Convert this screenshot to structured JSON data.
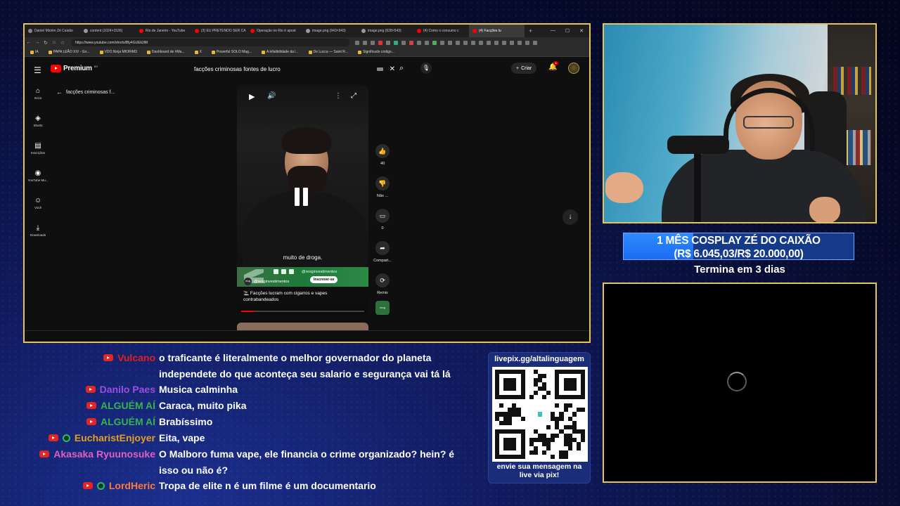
{
  "browser": {
    "tabs": [
      {
        "label": "Daniel Miorim Zé Caixão",
        "color": "#888888",
        "active": false
      },
      {
        "label": "content (1024×1536)",
        "color": "#9a9a9a",
        "active": false
      },
      {
        "label": "Rio de Janeiro - YouTube",
        "color": "#ff0000",
        "active": false
      },
      {
        "label": "(3) EU PRETENDO SER CA",
        "color": "#ff0000",
        "active": false
      },
      {
        "label": "Operação no Rio é apost",
        "color": "#ff0000",
        "active": false
      },
      {
        "label": "image.png (943×943)",
        "color": "#9a9a9a",
        "active": false
      },
      {
        "label": "image.png (628×543)",
        "color": "#9a9a9a",
        "active": false
      },
      {
        "label": "(4) Como o consumo c",
        "color": "#ff0000",
        "active": false
      },
      {
        "label": "(4) Facções lu",
        "color": "#ff0000",
        "active": true
      }
    ],
    "new_tab": "+",
    "url": "https://www.youtube.com/shorts/lBy4GUEk2iM",
    "bookmarks": [
      "IA",
      "PAPA LEÃO XIV - Go...",
      "VDO.Ninja MIORIM3",
      "Dashboard de #Ma...",
      "X",
      "Powerful SOLO Mag...",
      "A infalibilidade da l...",
      "De Lucca — Saint R...",
      "Significado código..."
    ]
  },
  "youtube": {
    "logo": "Premium",
    "logo_region": "BR",
    "search_value": "facções criminosas fontes de lucro",
    "create_label": "Criar",
    "notif_count": "4",
    "sidebar": [
      {
        "label": "Início",
        "icon": "home-icon",
        "glyph": "⌂"
      },
      {
        "label": "Shorts",
        "icon": "shorts-icon",
        "glyph": "◈"
      },
      {
        "label": "Inscrições",
        "icon": "subscriptions-icon",
        "glyph": "▤"
      },
      {
        "label": "YouTube Mu...",
        "icon": "youtube-music-icon",
        "glyph": "◉"
      },
      {
        "label": "Você",
        "icon": "you-icon",
        "glyph": "☺"
      },
      {
        "label": "Downloads",
        "icon": "downloads-icon",
        "glyph": "⤓"
      }
    ],
    "back_label": "facções criminosas f...",
    "video": {
      "subtitle": "muito de droga.",
      "banner_handle": "@reoginvestimentos",
      "channel": "@reoginvestimentos",
      "channel_avatar": "reog",
      "subscribe": "Inscrever-se",
      "title": "🚬 Facções lucram com cigarros e vapes contrabandeados",
      "progress": 0.1
    },
    "actions": [
      {
        "icon": "like-icon",
        "glyph": "👍",
        "label": "40"
      },
      {
        "icon": "dislike-icon",
        "glyph": "👎",
        "label": "Não ..."
      },
      {
        "icon": "comment-icon",
        "glyph": "▭",
        "label": "0"
      },
      {
        "icon": "share-icon",
        "glyph": "➦",
        "label": "Compart..."
      },
      {
        "icon": "remix-icon",
        "glyph": "⟳",
        "label": "Remix"
      }
    ],
    "reog_icon": "reog"
  },
  "goal": {
    "line1": "1 MÊS COSPLAY ZÉ DO CAIXÃO",
    "line2": "(R$ 6.045,03/R$ 20.000,00)",
    "progress": 0.302,
    "ends": "Termina em 3 dias"
  },
  "chat": [
    {
      "user": "Vulcano",
      "color": "#e02020",
      "member": false,
      "msg": "o traficante é literalmente o melhor governador do planeta independete do que aconteça seu salario e segurança vai tá lá"
    },
    {
      "user": "Danilo Paes",
      "color": "#9b4fe0",
      "member": false,
      "msg": "Musica calminha"
    },
    {
      "user": "ALGUÉM AÍ",
      "color": "#34b34f",
      "member": false,
      "msg": "Caraca, muito pika"
    },
    {
      "user": "ALGUÉM AÍ",
      "color": "#34b34f",
      "member": false,
      "msg": "Brabíssimo"
    },
    {
      "user": "EucharistEnjoyer",
      "color": "#e0a020",
      "member": true,
      "msg": "Eita, vape"
    },
    {
      "user": "Akasaka Ryuunosuke",
      "color": "#e060c0",
      "member": false,
      "msg": "O Malboro fuma vape, ele financia o crime organizado? hein? é isso ou não é?"
    },
    {
      "user": "LordHeric",
      "color": "#ff7a3a",
      "member": true,
      "msg": "Tropa de elite n é um filme é um documentario"
    }
  ],
  "qr": {
    "top": "livepix.gg/altalinguagem",
    "bottom_line1": "envie sua mensagem na",
    "bottom_line2": "live via pix!"
  },
  "colors": {
    "frame": "#e3c55a",
    "accent": "#1a6cf0",
    "youtube_red": "#ff0000"
  }
}
